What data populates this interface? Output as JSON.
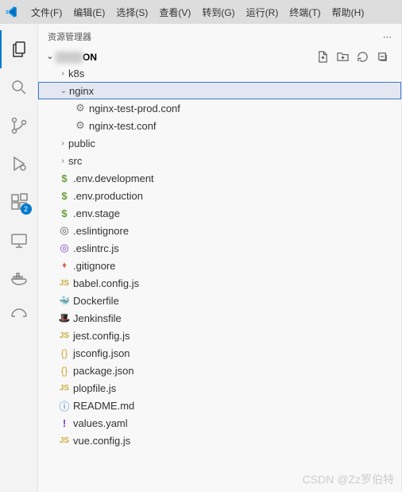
{
  "menu": {
    "file": "文件(F)",
    "edit": "编辑(E)",
    "select": "选择(S)",
    "view": "查看(V)",
    "goto": "转到(G)",
    "run": "运行(R)",
    "terminal": "终端(T)",
    "help": "帮助(H)"
  },
  "sidebar": {
    "title": "资源管理器",
    "root": "ON"
  },
  "activity": {
    "ext_badge": "2"
  },
  "tree": [
    {
      "name": "k8s",
      "type": "folder",
      "expanded": false,
      "indent": 1
    },
    {
      "name": "nginx",
      "type": "folder",
      "expanded": true,
      "indent": 1,
      "selected": true
    },
    {
      "name": "nginx-test-prod.conf",
      "type": "file",
      "icon": "gear",
      "indent": 2
    },
    {
      "name": "nginx-test.conf",
      "type": "file",
      "icon": "gear",
      "indent": 2
    },
    {
      "name": "public",
      "type": "folder",
      "expanded": false,
      "indent": 1
    },
    {
      "name": "src",
      "type": "folder",
      "expanded": false,
      "indent": 1
    },
    {
      "name": ".env.development",
      "type": "file",
      "icon": "dollar",
      "indent": 1
    },
    {
      "name": ".env.production",
      "type": "file",
      "icon": "dollar",
      "indent": 1
    },
    {
      "name": ".env.stage",
      "type": "file",
      "icon": "dollar",
      "indent": 1
    },
    {
      "name": ".eslintignore",
      "type": "file",
      "icon": "target",
      "indent": 1
    },
    {
      "name": ".eslintrc.js",
      "type": "file",
      "icon": "target-purple",
      "indent": 1
    },
    {
      "name": ".gitignore",
      "type": "file",
      "icon": "git",
      "indent": 1
    },
    {
      "name": "babel.config.js",
      "type": "file",
      "icon": "js",
      "indent": 1
    },
    {
      "name": "Dockerfile",
      "type": "file",
      "icon": "docker",
      "indent": 1
    },
    {
      "name": "Jenkinsfile",
      "type": "file",
      "icon": "jenkins",
      "indent": 1
    },
    {
      "name": "jest.config.js",
      "type": "file",
      "icon": "js",
      "indent": 1
    },
    {
      "name": "jsconfig.json",
      "type": "file",
      "icon": "json",
      "indent": 1
    },
    {
      "name": "package.json",
      "type": "file",
      "icon": "json",
      "indent": 1
    },
    {
      "name": "plopfile.js",
      "type": "file",
      "icon": "js",
      "indent": 1
    },
    {
      "name": "README.md",
      "type": "file",
      "icon": "info",
      "indent": 1
    },
    {
      "name": "values.yaml",
      "type": "file",
      "icon": "excl",
      "indent": 1
    },
    {
      "name": "vue.config.js",
      "type": "file",
      "icon": "js",
      "indent": 1
    }
  ],
  "watermark": "CSDN @Zz罗伯特"
}
